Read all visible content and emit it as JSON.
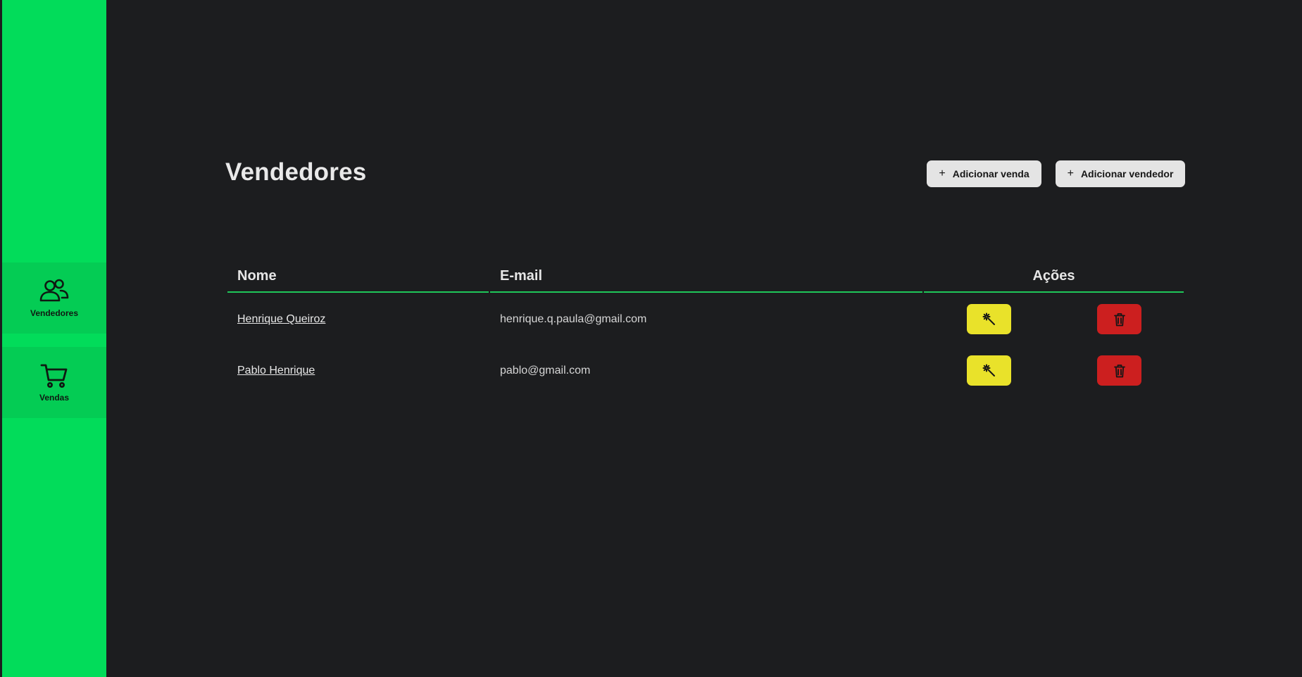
{
  "sidebar": {
    "items": [
      {
        "label": "Vendedores",
        "icon": "users-icon"
      },
      {
        "label": "Vendas",
        "icon": "cart-icon"
      }
    ]
  },
  "header": {
    "title": "Vendedores",
    "add_sale_label": "Adicionar venda",
    "add_seller_label": "Adicionar vendedor",
    "plus_glyph": "+"
  },
  "table": {
    "columns": [
      "Nome",
      "E-mail",
      "Ações"
    ],
    "rows": [
      {
        "name": "Henrique Queiroz",
        "email": "henrique.q.paula@gmail.com"
      },
      {
        "name": "Pablo Henrique",
        "email": "pablo@gmail.com"
      }
    ]
  },
  "colors": {
    "sidebar": "#02dc5a",
    "accent": "#1fc759",
    "edit": "#e9e22a",
    "delete": "#cc1f1f",
    "background": "#1c1d1f"
  }
}
